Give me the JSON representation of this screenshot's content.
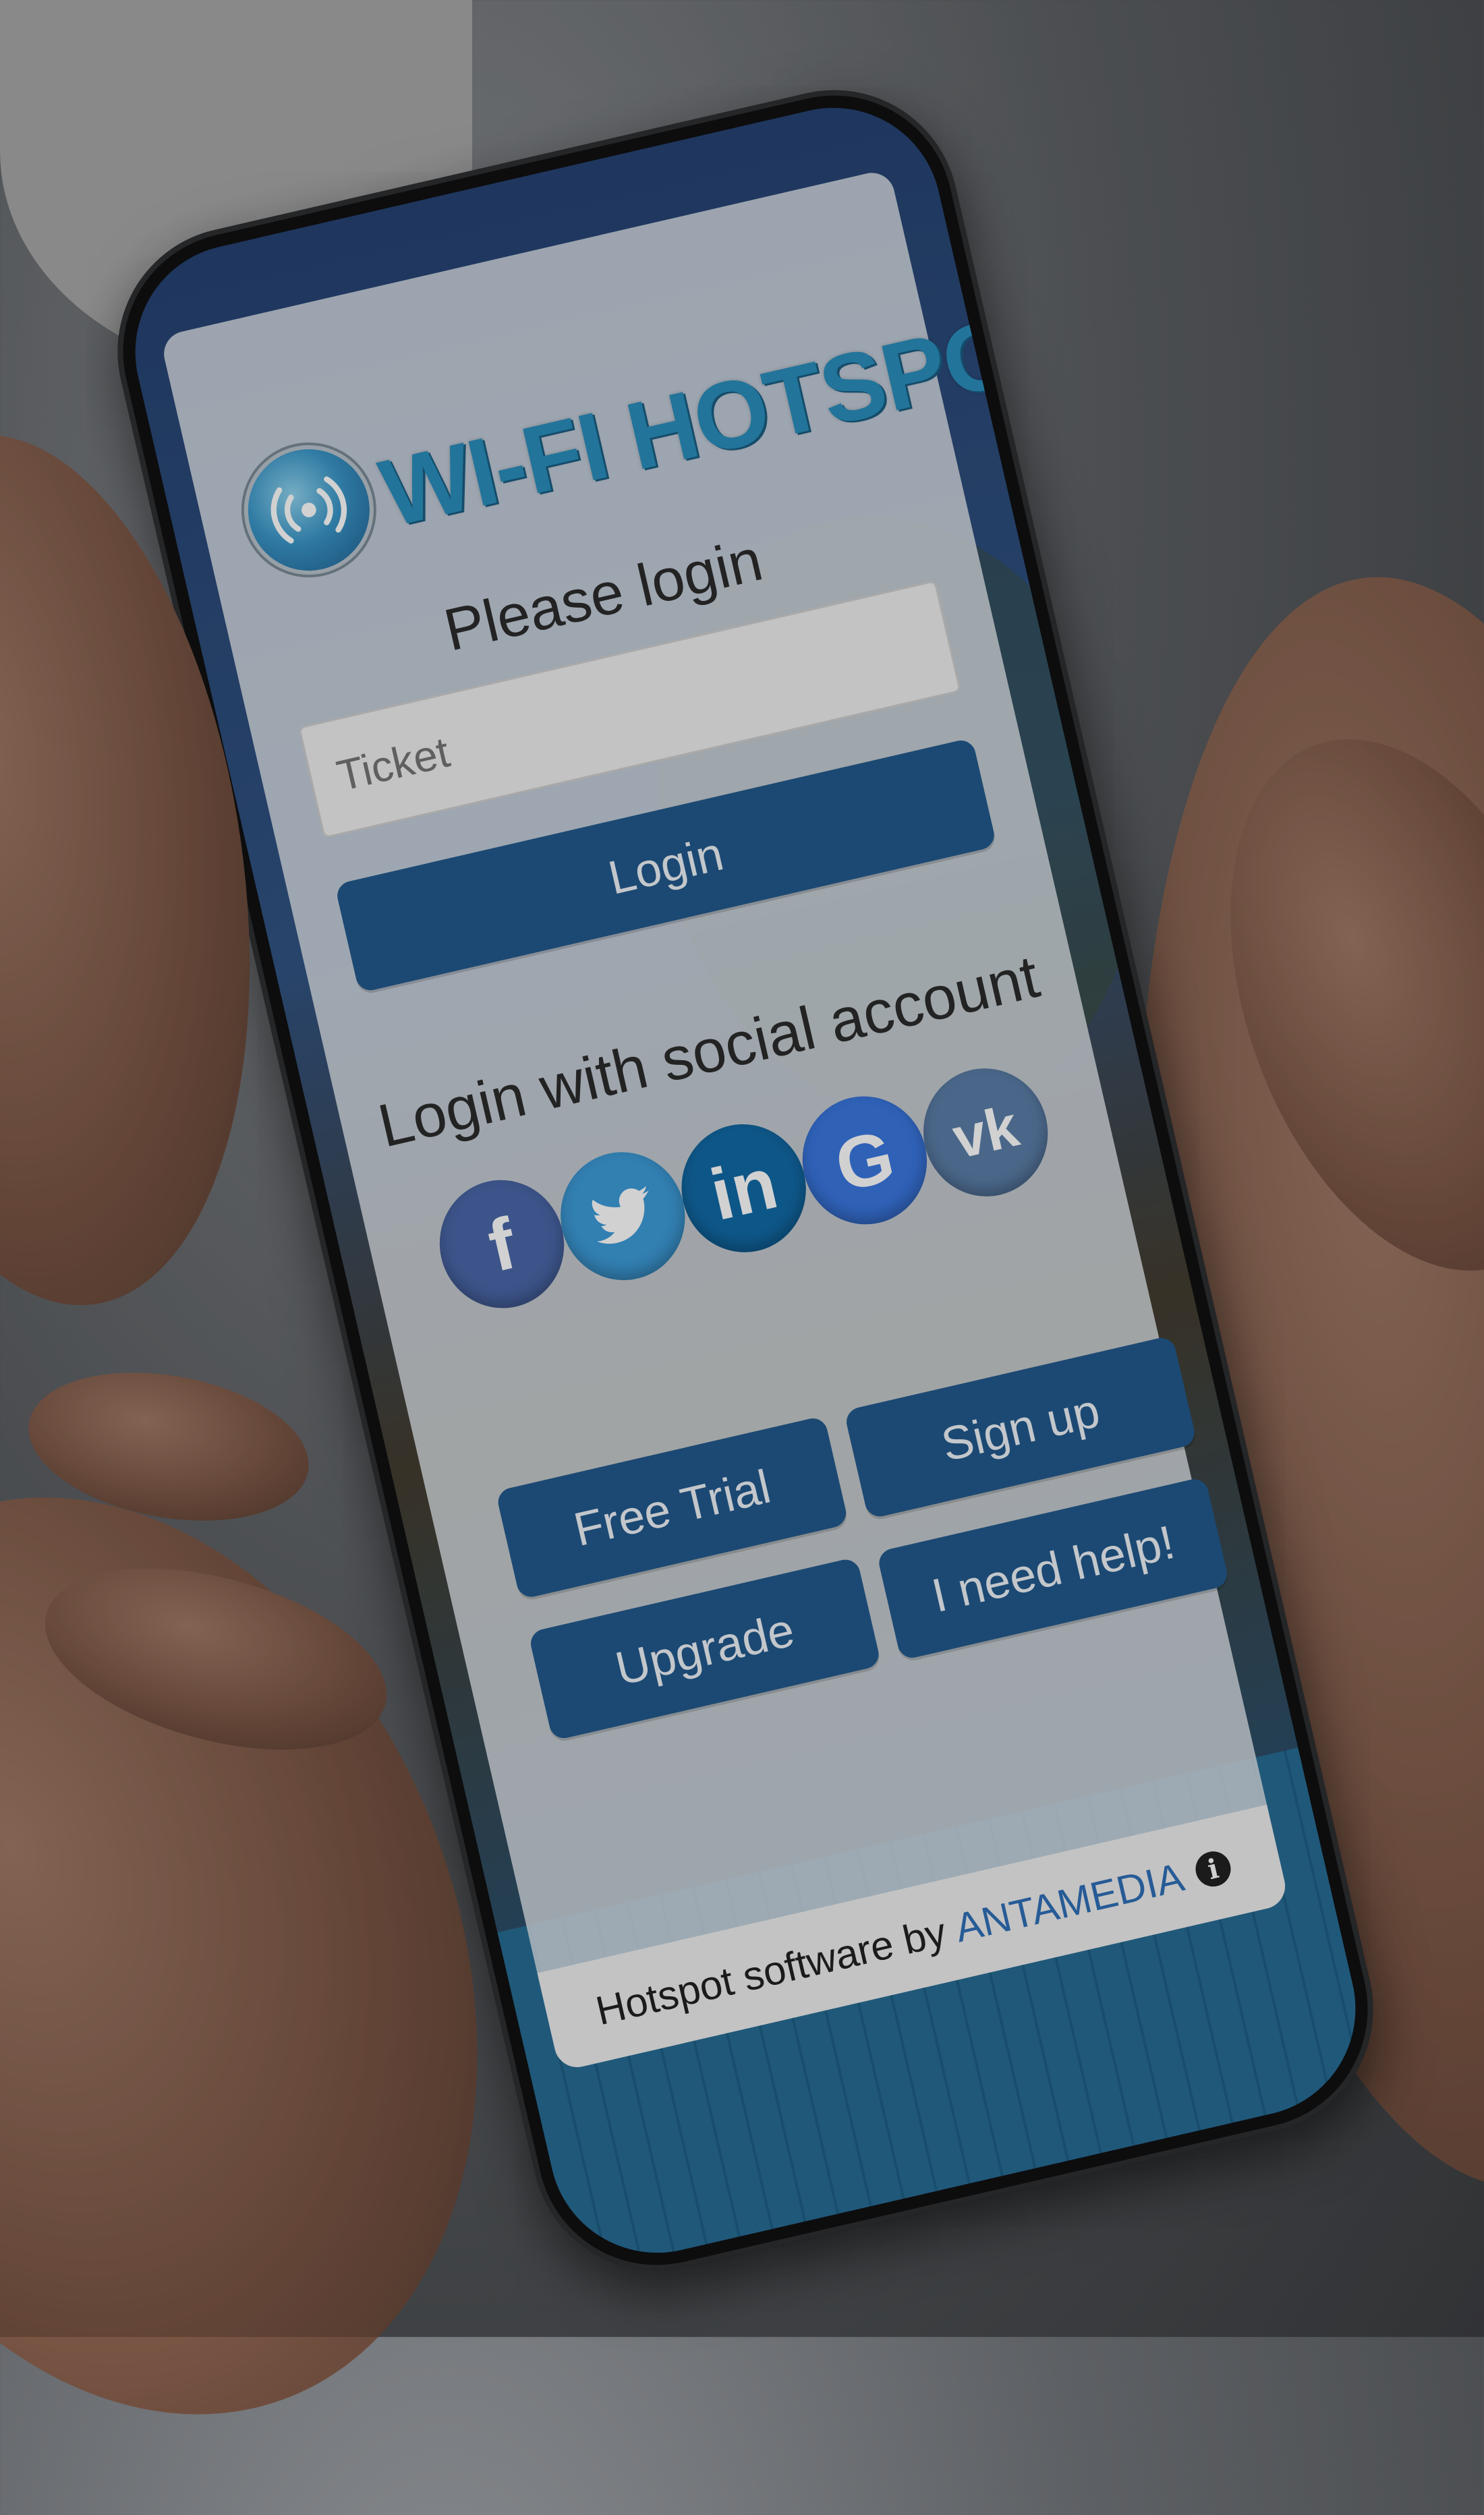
{
  "brand": {
    "title": "WI-FI HOTSPOT",
    "logo_icon": "wifi-signal-icon"
  },
  "login": {
    "heading": "Please login",
    "ticket_placeholder": "Ticket",
    "login_button": "Login"
  },
  "social": {
    "heading": "Login with social account",
    "providers": [
      {
        "name": "facebook-icon",
        "glyph": "f",
        "color": "#4a67a8"
      },
      {
        "name": "twitter-icon",
        "glyph": "",
        "color": "#3d9bd8"
      },
      {
        "name": "linkedin-icon",
        "glyph": "in",
        "color": "#116aa6"
      },
      {
        "name": "google-icon",
        "glyph": "G",
        "color": "#3a77e0"
      },
      {
        "name": "vk-icon",
        "glyph": "vk",
        "color": "#5b7ea8"
      }
    ]
  },
  "actions": {
    "free_trial": "Free Trial",
    "sign_up": "Sign up",
    "upgrade": "Upgrade",
    "help": "I need help!"
  },
  "footer": {
    "text": "Hotspot software by",
    "link": "ANTAMEDIA",
    "info_icon": "info-icon"
  },
  "colors": {
    "primary_button": "#235a8d",
    "brand_text": "#2a8ebc",
    "footer_link": "#2f6fb8"
  }
}
